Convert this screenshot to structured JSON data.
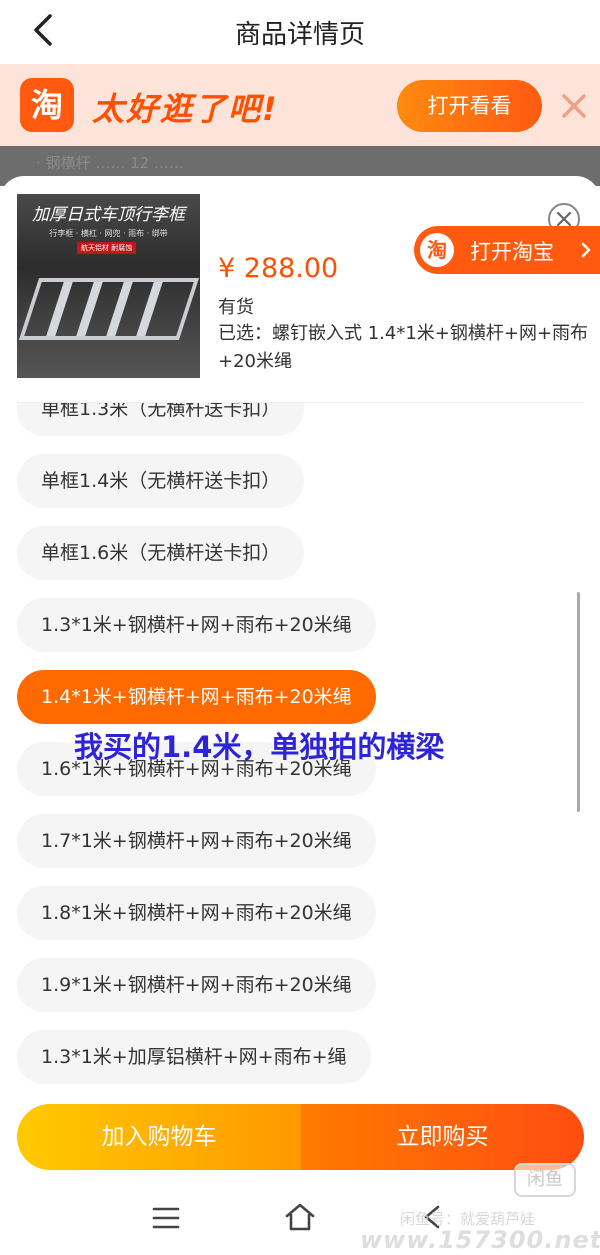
{
  "nav": {
    "title": "商品详情页",
    "back_icon": "chevron-left-icon"
  },
  "banner": {
    "logo_char": "淘",
    "slogan": "太好逛了吧!",
    "open_label": "打开看看",
    "close_icon": "close-icon"
  },
  "background_text": "· 钢横杆 …… 12 ……",
  "product": {
    "image_caption": "加厚日式车顶行李框",
    "image_subtitle": "行李框 · 横杠 · 网兜 · 雨布 · 绑带",
    "image_tag": "航天铝材 耐腐蚀",
    "price": "¥ 288.00",
    "stock": "有货",
    "selected": "已选：螺钉嵌入式 1.4*1米+钢横杆+网+雨布+20米绳",
    "open_taobao_label": "打开淘宝",
    "open_taobao_logo": "淘"
  },
  "options": [
    {
      "label": "单框1.3米（无横杆送卡扣）",
      "selected": false
    },
    {
      "label": "单框1.4米（无横杆送卡扣）",
      "selected": false
    },
    {
      "label": "单框1.6米（无横杆送卡扣）",
      "selected": false
    },
    {
      "label": "1.3*1米+钢横杆+网+雨布+20米绳",
      "selected": false
    },
    {
      "label": "1.4*1米+钢横杆+网+雨布+20米绳",
      "selected": true
    },
    {
      "label": "1.6*1米+钢横杆+网+雨布+20米绳",
      "selected": false
    },
    {
      "label": "1.7*1米+钢横杆+网+雨布+20米绳",
      "selected": false
    },
    {
      "label": "1.8*1米+钢横杆+网+雨布+20米绳",
      "selected": false
    },
    {
      "label": "1.9*1米+钢横杆+网+雨布+20米绳",
      "selected": false
    },
    {
      "label": "1.3*1米+加厚铝横杆+网+雨布+绳",
      "selected": false
    }
  ],
  "annotation": "我买的1.4米，单独拍的横梁",
  "actions": {
    "add_to_cart": "加入购物车",
    "buy_now": "立即购买"
  },
  "watermark": {
    "badge": "闲鱼",
    "text": "闲鱼号：就爱葫芦娃",
    "domain": "www.157300.net"
  },
  "colors": {
    "accent": "#ff5000",
    "selected_option": "#ff6a00",
    "annotation": "#2d23d8"
  }
}
